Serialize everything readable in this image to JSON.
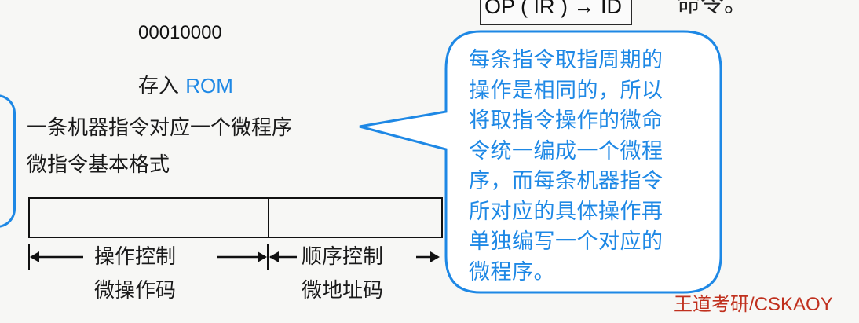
{
  "header": {
    "formula": "OP ( IR ) → ID",
    "cropped_right_text": "命令。"
  },
  "content": {
    "binary_code": "00010000",
    "store_prefix": "存入 ",
    "store_target": "ROM",
    "line1": "一条机器指令对应一个微程序",
    "line2": "微指令基本格式"
  },
  "format": {
    "field1_top": "操作控制",
    "field1_bottom": "微操作码",
    "field2_top": "顺序控制",
    "field2_bottom": "微地址码"
  },
  "callout": {
    "lines": [
      "每条指令取指周期的",
      "操作是相同的，所以",
      "将取指令操作的微命",
      "令统一编成一个微程",
      "序，而每条机器指令",
      "所对应的具体操作再",
      "单独编写一个对应的",
      "微程序。"
    ]
  },
  "watermark": "王道考研/CSKAOY",
  "colors": {
    "accent_blue": "#1e88e5",
    "watermark_red": "#c0301e",
    "text": "#1a1a1a"
  }
}
